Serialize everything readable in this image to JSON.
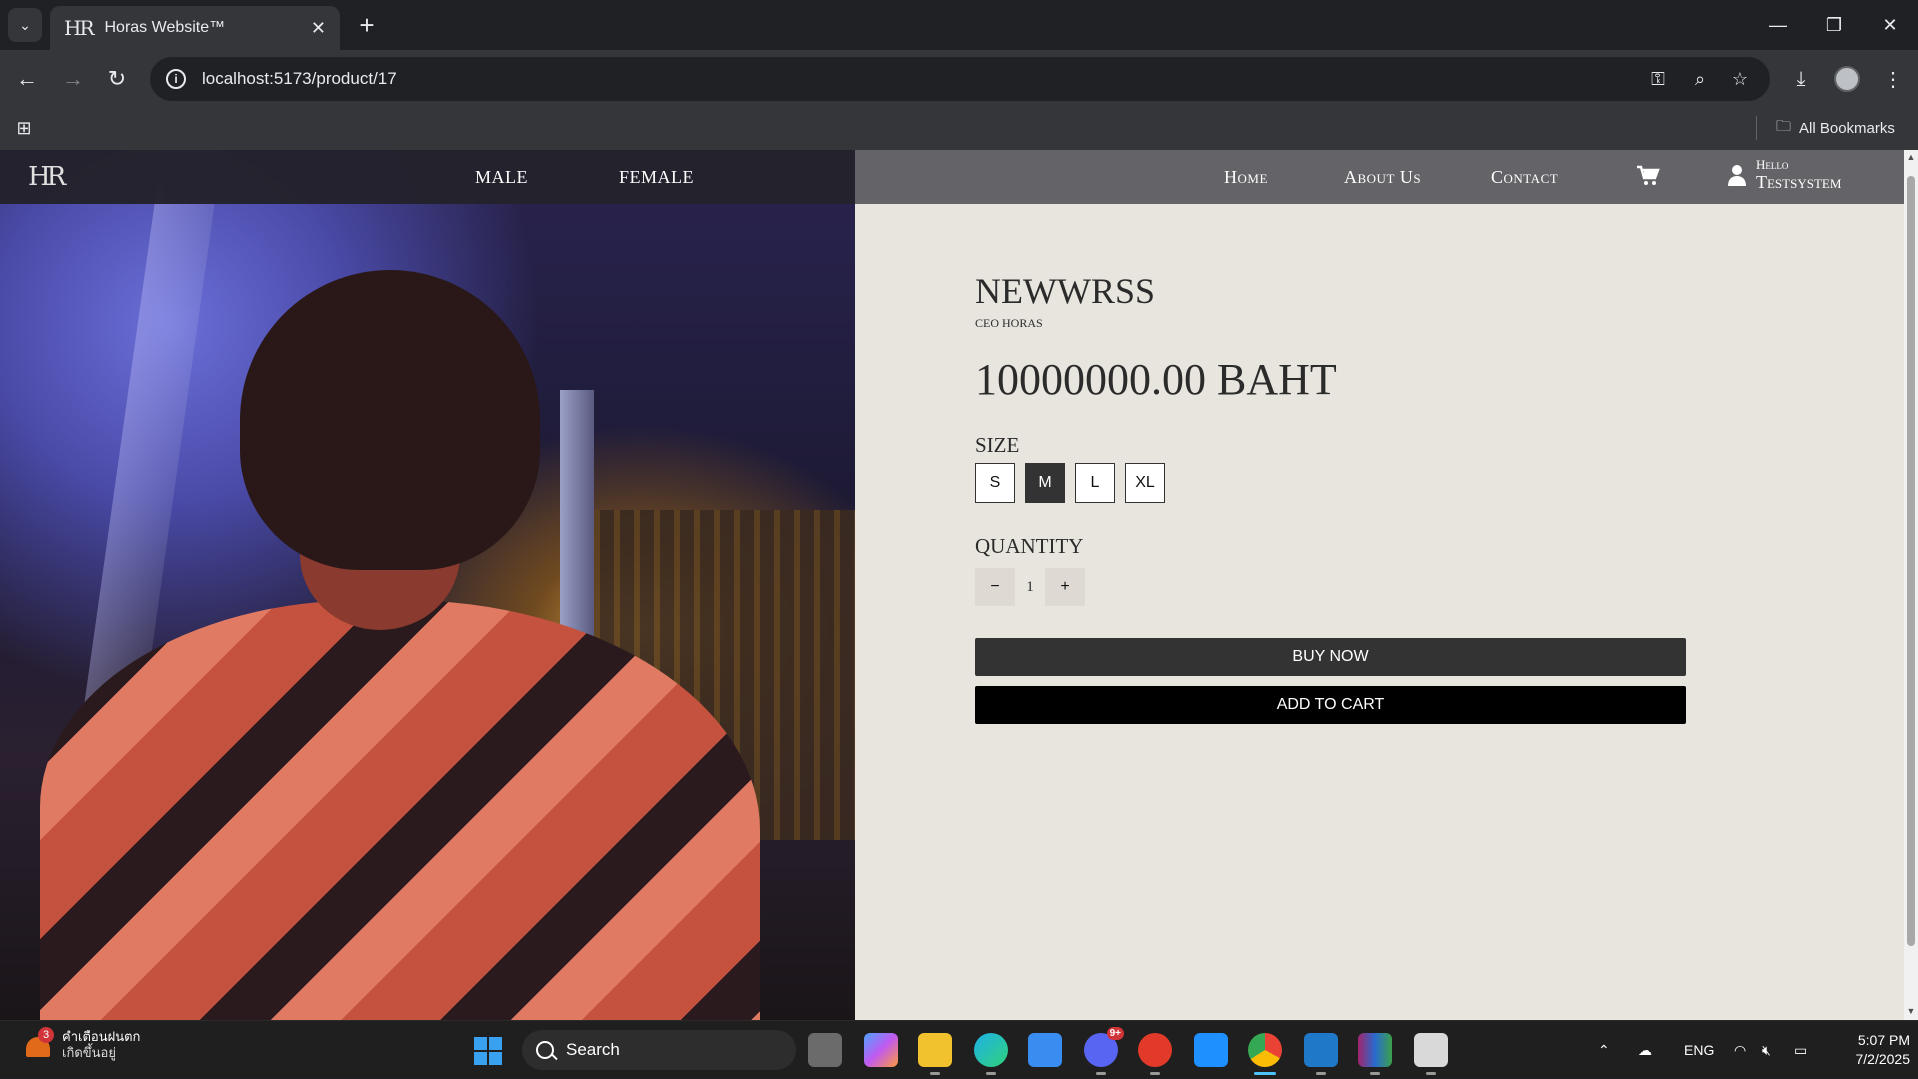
{
  "browser": {
    "tab_title": "Horas Website™",
    "tab_favicon": "HR",
    "url": "localhost:5173/product/17",
    "bookmarks_label": "All Bookmarks"
  },
  "site": {
    "logo": "HR",
    "nav_left": [
      "MALE",
      "FEMALE"
    ],
    "nav_right": [
      "Home",
      "About Us",
      "Contact"
    ],
    "user_greeting": "Hello",
    "user_name": "Testsystem"
  },
  "product": {
    "name": "NEWWRSS",
    "brand": "CEO HORAS",
    "price": "10000000.00 BAHT",
    "size_label": "SIZE",
    "sizes": [
      "S",
      "M",
      "L",
      "XL"
    ],
    "selected_size": "M",
    "quantity_label": "QUANTITY",
    "quantity": "1",
    "qty_minus": "−",
    "qty_plus": "+",
    "buy_now": "BUY NOW",
    "add_to_cart": "ADD TO CART"
  },
  "taskbar": {
    "weather_badge": "3",
    "weather_line1": "คำเตือนฝนตก",
    "weather_line2": "เกิดขึ้นอยู่",
    "search_placeholder": "Search",
    "language": "ENG",
    "time": "5:07 PM",
    "date": "7/2/2025",
    "discord_badge": "9+"
  },
  "colors": {
    "page_bg": "#e8e5df",
    "nav_bg": "#58585c",
    "button_dark": "#333333",
    "button_black": "#000000"
  }
}
